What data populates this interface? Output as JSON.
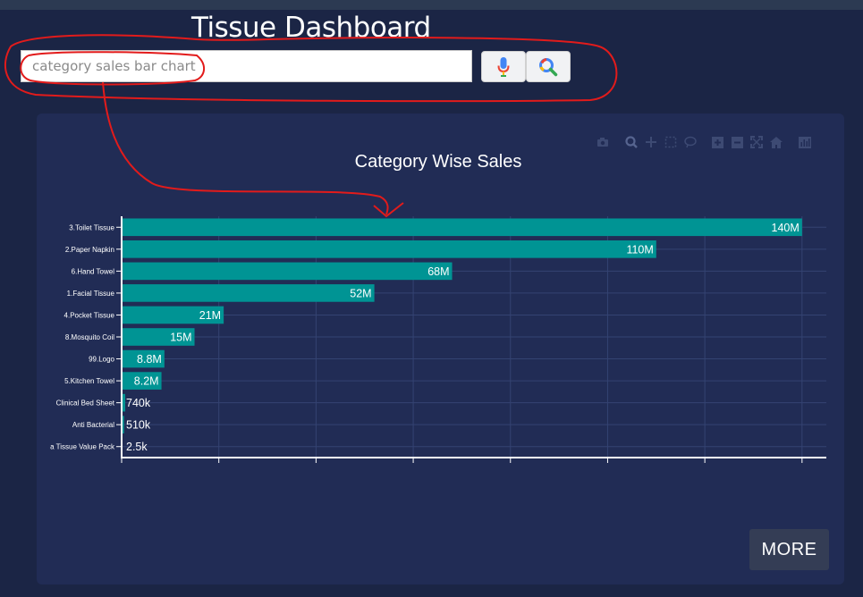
{
  "app": {
    "title": "Tissue Dashboard"
  },
  "search": {
    "placeholder": "category sales bar chart",
    "mic_icon": "mic-icon",
    "search_icon": "search-icon"
  },
  "modebar": {
    "icons": [
      "camera-icon",
      "zoom-icon",
      "pan-icon",
      "box-select-icon",
      "lasso-select-icon",
      "zoom-in-icon",
      "zoom-out-icon",
      "autoscale-icon",
      "reset-axes-icon",
      "plotly-logo-icon"
    ]
  },
  "colors": {
    "bar": "#009494",
    "background": "#1b2545",
    "card": "#212c55",
    "annotation": "#e21b1b"
  },
  "chart_data": {
    "type": "bar",
    "orientation": "horizontal",
    "title": "Category Wise Sales",
    "xlabel": "",
    "ylabel": "",
    "xlim": [
      0,
      145000000
    ],
    "grid": true,
    "categories": [
      "3.Toilet Tissue",
      "2.Paper Napkin",
      "6.Hand Towel",
      "1.Facial Tissue",
      "4.Pocket Tissue",
      "8.Mosquito Coil",
      "99.Logo",
      "5.Kitchen Towel",
      "Clinical Bed Sheet",
      "Anti Bacterial",
      "a Tissue Value Pack"
    ],
    "values": [
      140000000,
      110000000,
      68000000,
      52000000,
      21000000,
      15000000,
      8800000,
      8200000,
      740000,
      510000,
      2500
    ],
    "labels": [
      "140M",
      "110M",
      "68M",
      "52M",
      "21M",
      "15M",
      "8.8M",
      "8.2M",
      "740k",
      "510k",
      "2.5k"
    ]
  },
  "more": {
    "label": "MORE"
  }
}
